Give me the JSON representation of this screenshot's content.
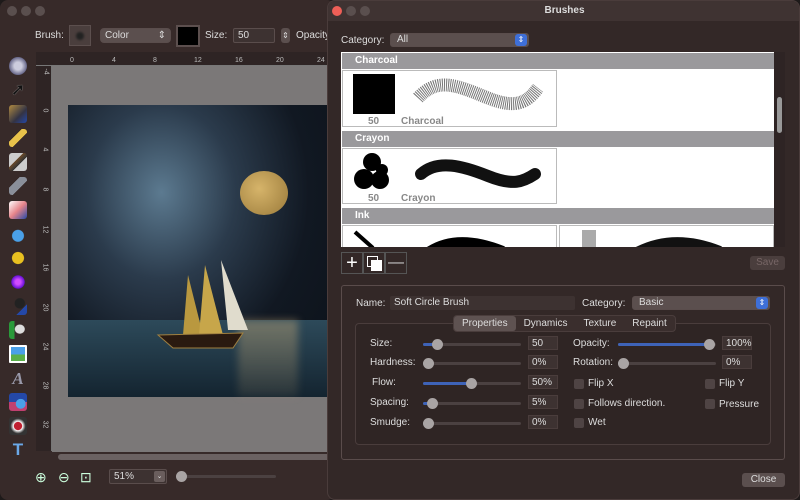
{
  "main": {
    "toolbar": {
      "brush_label": "Brush:",
      "color_mode": "Color",
      "color_swatch": "#000000",
      "size_label": "Size:",
      "size_value": "50",
      "opacity_label": "Opacity"
    },
    "ruler_top": [
      "0",
      "4",
      "8",
      "12",
      "16",
      "20",
      "24"
    ],
    "ruler_left": [
      "-4",
      "0",
      "4",
      "8",
      "12",
      "16",
      "20",
      "24",
      "28",
      "32"
    ],
    "tools": [
      "gear-icon",
      "arrow-select-icon",
      "lasso-icon",
      "pencil-icon",
      "brush-icon",
      "eyedropper-icon",
      "eraser-icon",
      "blur-drop-icon",
      "clone-icon",
      "gradient-circle-icon",
      "magnifier-smudge-icon",
      "fill-bucket-icon",
      "image-icon",
      "text-icon",
      "shapes-icon",
      "stamp-icon",
      "hammer-icon"
    ],
    "zoom": {
      "value": "51%",
      "level_percent": 2
    }
  },
  "dialog": {
    "title": "Brushes",
    "category_label": "Category:",
    "category_value": "All",
    "groups": [
      {
        "name": "Charcoal",
        "items": [
          {
            "size": "50",
            "name": "Charcoal"
          }
        ]
      },
      {
        "name": "Crayon",
        "items": [
          {
            "size": "50",
            "name": "Crayon"
          }
        ]
      },
      {
        "name": "Ink",
        "items": []
      }
    ],
    "save_label": "Save",
    "close_label": "Close",
    "editor": {
      "name_label": "Name:",
      "name_value": "Soft Circle Brush",
      "category_label": "Category:",
      "category_value": "Basic",
      "tabs": [
        "Properties",
        "Dynamics",
        "Texture",
        "Repaint"
      ],
      "active_tab": "Properties",
      "sliders": [
        {
          "label": "Size:",
          "value": "50",
          "fraction": 0.1
        },
        {
          "label": "Hardness:",
          "value": "0%",
          "fraction": 0
        },
        {
          "label": "Flow:",
          "value": "50%",
          "fraction": 0.5
        },
        {
          "label": "Spacing:",
          "value": "5%",
          "fraction": 0.05
        },
        {
          "label": "Smudge:",
          "value": "0%",
          "fraction": 0
        },
        {
          "label": "Opacity:",
          "value": "100%",
          "fraction": 1
        },
        {
          "label": "Rotation:",
          "value": "0%",
          "fraction": 0
        }
      ],
      "checkboxes": [
        {
          "label": "Flip X",
          "checked": false
        },
        {
          "label": "Flip Y",
          "checked": false
        },
        {
          "label": "Follows direction.",
          "checked": false
        },
        {
          "label": "Pressure",
          "checked": false
        },
        {
          "label": "Wet",
          "checked": false
        }
      ]
    },
    "accent": "#3e6fd8"
  }
}
